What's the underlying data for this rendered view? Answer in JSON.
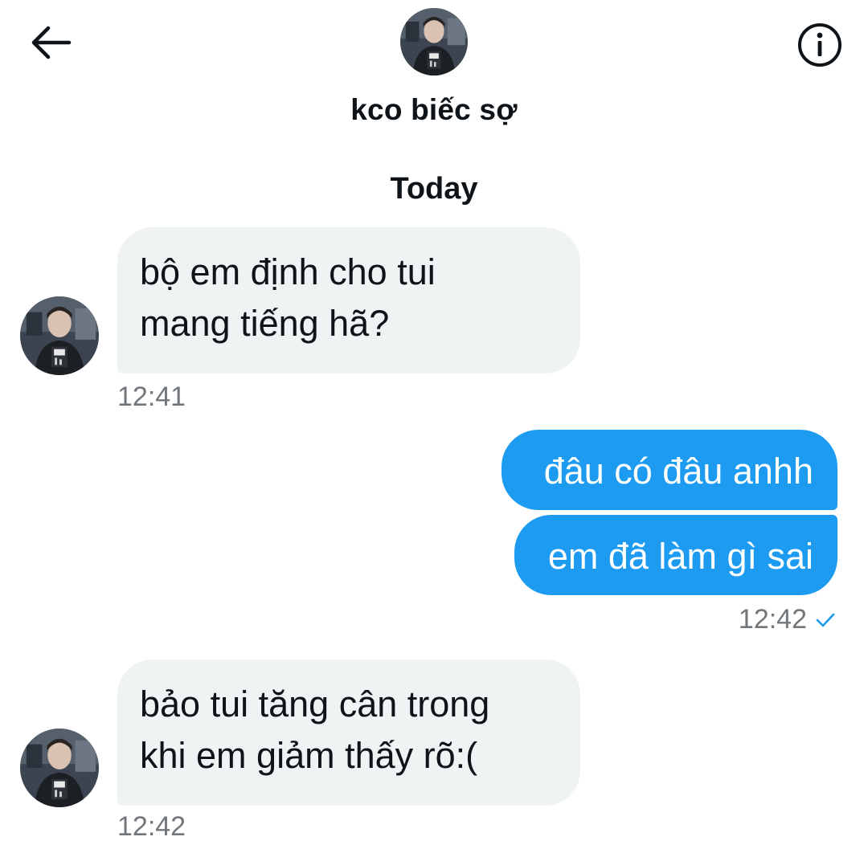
{
  "header": {
    "back_icon": "arrow-left-icon",
    "info_icon": "info-circle-icon",
    "contact_name": "kco biếc sợ"
  },
  "date_divider": "Today",
  "messages": [
    {
      "direction": "incoming",
      "lines": [
        "bộ em định cho tui",
        "mang tiếng hã?"
      ],
      "time": "12:41"
    },
    {
      "direction": "outgoing",
      "lines": [
        "đâu có đâu anhh"
      ]
    },
    {
      "direction": "outgoing",
      "lines": [
        "em đã làm gì sai"
      ],
      "time": "12:42",
      "status_icon": "check-icon"
    },
    {
      "direction": "incoming",
      "lines": [
        "bảo tui tăng cân trong",
        "khi em giảm thấy rõ:("
      ],
      "time": "12:42"
    }
  ],
  "colors": {
    "outgoing_bubble": "#1d9bf0",
    "incoming_bubble": "#eff3f4",
    "timestamp": "#71767b",
    "read_check": "#1d9bf0"
  }
}
